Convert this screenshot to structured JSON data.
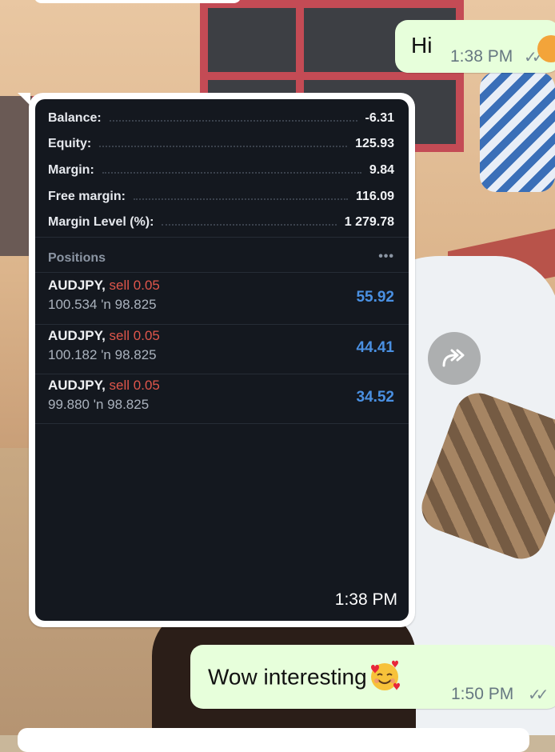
{
  "chat": {
    "msg_hi": {
      "text": "Hi",
      "time": "1:38 PM",
      "status_icon": "double-check-icon"
    },
    "image_message": {
      "time": "1:38 PM",
      "account": {
        "rows": [
          {
            "label": "Balance:",
            "value": "-6.31"
          },
          {
            "label": "Equity:",
            "value": "125.93"
          },
          {
            "label": "Margin:",
            "value": "9.84"
          },
          {
            "label": "Free margin:",
            "value": "116.09"
          },
          {
            "label": "Margin Level (%):",
            "value": "1 279.78"
          }
        ]
      },
      "positions_title": "Positions",
      "positions_more": "•••",
      "positions": [
        {
          "symbol": "AUDJPY,",
          "side": "sell 0.05",
          "open": "100.534",
          "arrow": "'n",
          "current": "98.825",
          "profit": "55.92"
        },
        {
          "symbol": "AUDJPY,",
          "side": "sell 0.05",
          "open": "100.182",
          "arrow": "'n",
          "current": "98.825",
          "profit": "44.41"
        },
        {
          "symbol": "AUDJPY,",
          "side": "sell 0.05",
          "open": "99.880",
          "arrow": "'n",
          "current": "98.825",
          "profit": "34.52"
        }
      ]
    },
    "forward_icon": "forward-icon",
    "msg_wow": {
      "text": "Wow interesting",
      "emoji": "smiling-face-with-hearts-emoji",
      "time": "1:50 PM",
      "status_icon": "double-check-icon"
    }
  },
  "colors": {
    "outgoing_bubble": "#e7ffdb",
    "screen_bg": "#14181f",
    "sell": "#e0564b",
    "profit": "#4a90e2"
  }
}
